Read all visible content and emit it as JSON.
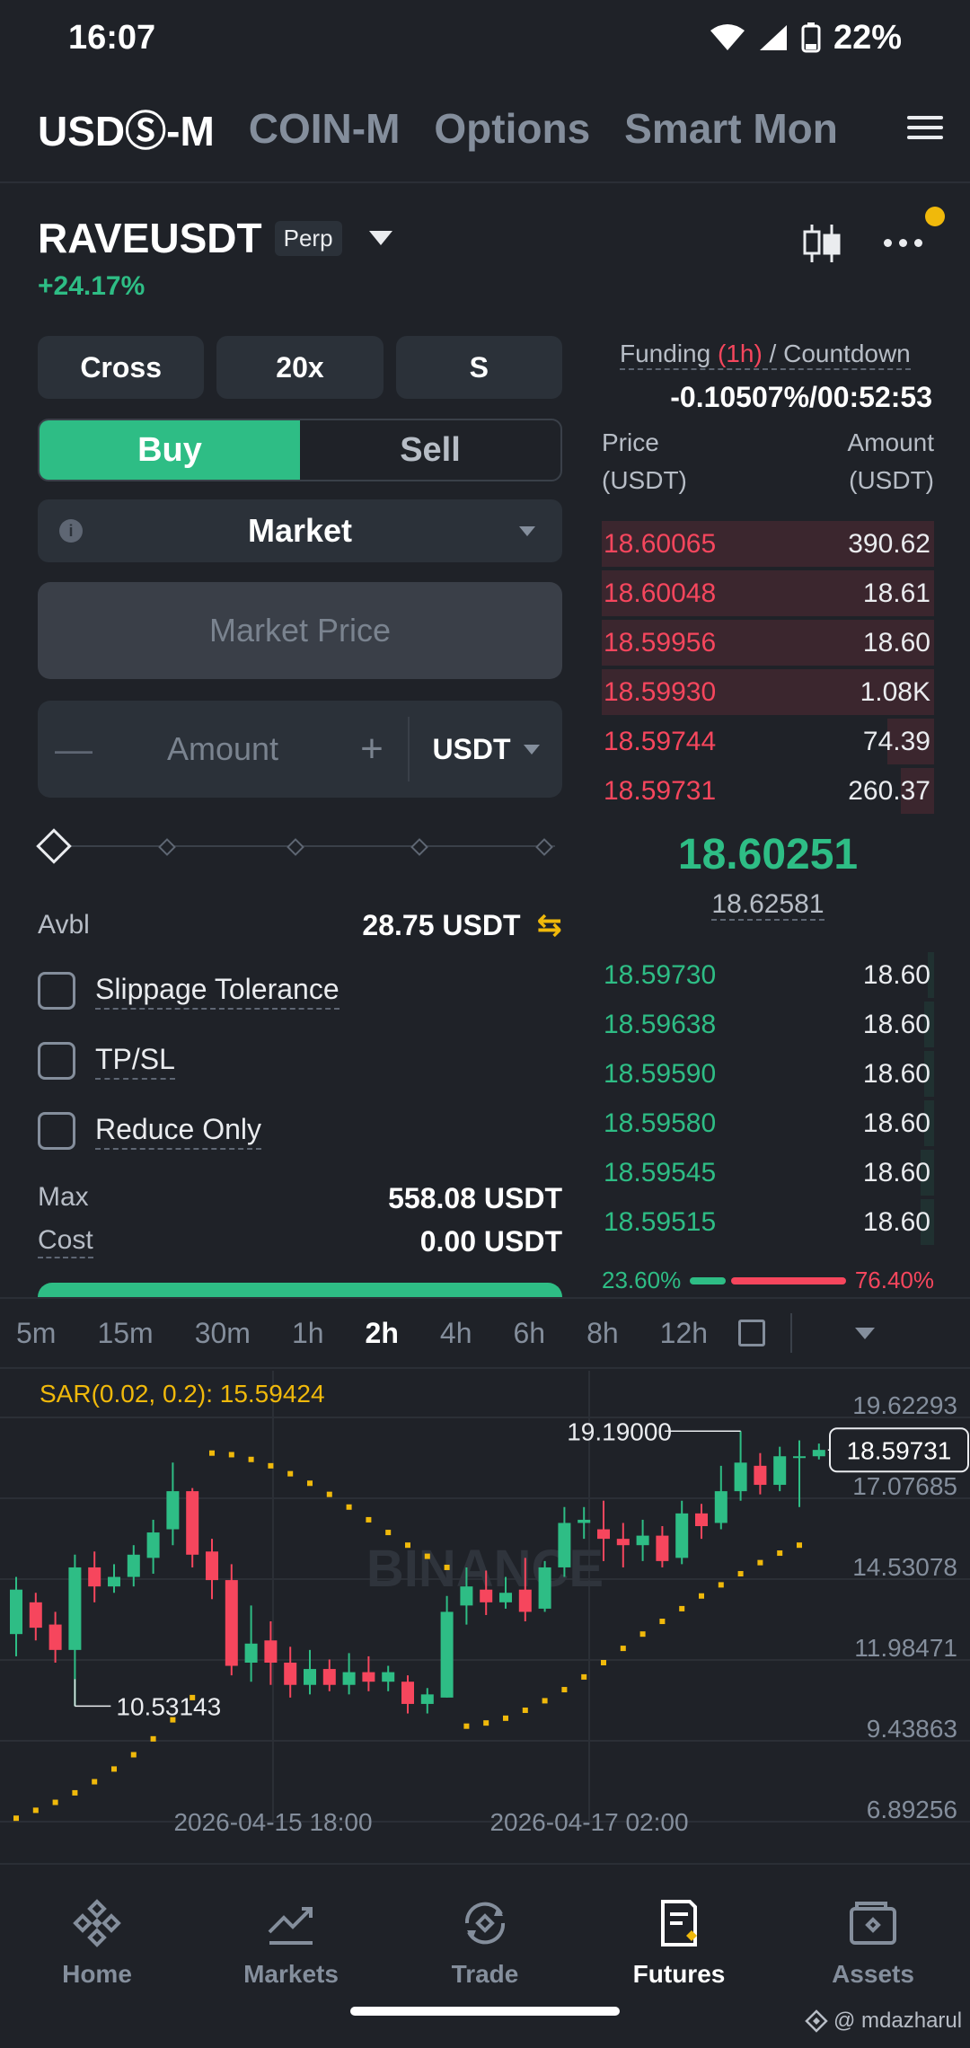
{
  "status": {
    "time": "16:07",
    "battery": "22%"
  },
  "top_tabs": [
    "USDⓈ-M",
    "COIN-M",
    "Options",
    "Smart Mon"
  ],
  "symbol": {
    "name": "RAVEUSDT",
    "badge": "Perp",
    "change": "+24.17%"
  },
  "options": {
    "margin_mode": "Cross",
    "leverage": "20x",
    "mode": "S"
  },
  "side": {
    "buy": "Buy",
    "sell": "Sell"
  },
  "order_type": "Market",
  "price_field": "Market Price",
  "amount": {
    "placeholder": "Amount",
    "unit": "USDT",
    "minus": "—",
    "plus": "+"
  },
  "avbl": {
    "label": "Avbl",
    "value": "28.75 USDT"
  },
  "checks": {
    "slippage": "Slippage Tolerance",
    "tpsl": "TP/SL",
    "reduce": "Reduce Only"
  },
  "max": {
    "label": "Max",
    "value": "558.08 USDT"
  },
  "cost": {
    "label": "Cost",
    "value": "0.00 USDT"
  },
  "funding": {
    "label_a": "Funding ",
    "label_hl": "(1h)",
    "label_b": " / Countdown",
    "value": "-0.10507%/00:52:53"
  },
  "orderbook": {
    "price_header_1": "Price",
    "price_header_2": "(USDT)",
    "amount_header_1": "Amount",
    "amount_header_2": "(USDT)",
    "asks": [
      {
        "price": "18.60065",
        "amount": "390.62",
        "depth": 1.0
      },
      {
        "price": "18.60048",
        "amount": "18.61",
        "depth": 1.0
      },
      {
        "price": "18.59956",
        "amount": "18.60",
        "depth": 1.0
      },
      {
        "price": "18.59930",
        "amount": "1.08K",
        "depth": 1.0
      },
      {
        "price": "18.59744",
        "amount": "74.39",
        "depth": 0.14
      },
      {
        "price": "18.59731",
        "amount": "260.37",
        "depth": 0.1
      }
    ],
    "last_price": "18.60251",
    "mark_price": "18.62581",
    "bids": [
      {
        "price": "18.59730",
        "amount": "18.60",
        "depth": 0.02
      },
      {
        "price": "18.59638",
        "amount": "18.60",
        "depth": 0.03
      },
      {
        "price": "18.59590",
        "amount": "18.60",
        "depth": 0.03
      },
      {
        "price": "18.59580",
        "amount": "18.60",
        "depth": 0.03
      },
      {
        "price": "18.59545",
        "amount": "18.60",
        "depth": 0.04
      },
      {
        "price": "18.59515",
        "amount": "18.60",
        "depth": 0.04
      }
    ],
    "buy_ratio": "23.60%",
    "sell_ratio": "76.40%",
    "buy_ratio_value": 23.6
  },
  "intervals": [
    "5m",
    "15m",
    "30m",
    "1h",
    "2h",
    "4h",
    "6h",
    "8h",
    "12h"
  ],
  "active_interval": "2h",
  "chart_data": {
    "type": "candlestick",
    "indicator": "SAR(0.02, 0.2): 15.59424",
    "watermark": "BINANCE",
    "y_ticks": [
      "19.62293",
      "17.07685",
      "14.53078",
      "11.98471",
      "9.43863",
      "6.89256"
    ],
    "x_ticks": [
      "2026-04-15 18:00",
      "2026-04-17 02:00"
    ],
    "high_label": "19.19000",
    "low_label": "10.53143",
    "current_label": "18.59731",
    "ylim": [
      6.89256,
      19.62293
    ],
    "candles": [
      [
        12.8,
        14.2,
        12.1,
        14.6
      ],
      [
        13.8,
        13.0,
        12.6,
        14.1
      ],
      [
        13.1,
        12.3,
        11.9,
        13.5
      ],
      [
        12.3,
        14.9,
        10.53,
        15.3
      ],
      [
        14.9,
        14.3,
        13.8,
        15.4
      ],
      [
        14.3,
        14.6,
        14.1,
        15.0
      ],
      [
        14.6,
        15.3,
        14.3,
        15.6
      ],
      [
        15.2,
        16.0,
        14.7,
        16.4
      ],
      [
        16.1,
        17.3,
        15.6,
        18.2
      ],
      [
        17.3,
        15.3,
        14.9,
        17.4
      ],
      [
        15.4,
        14.5,
        13.9,
        15.8
      ],
      [
        14.5,
        11.8,
        11.5,
        15.0
      ],
      [
        11.9,
        12.5,
        11.3,
        13.7
      ],
      [
        12.6,
        11.9,
        11.2,
        13.2
      ],
      [
        11.9,
        11.2,
        10.8,
        12.4
      ],
      [
        11.2,
        11.7,
        10.9,
        12.3
      ],
      [
        11.7,
        11.2,
        11.0,
        12.0
      ],
      [
        11.2,
        11.6,
        10.9,
        12.2
      ],
      [
        11.6,
        11.3,
        11.0,
        12.1
      ],
      [
        11.3,
        11.6,
        11.0,
        11.8
      ],
      [
        11.3,
        10.6,
        10.3,
        11.5
      ],
      [
        10.6,
        10.9,
        10.3,
        11.1
      ],
      [
        10.8,
        13.5,
        10.8,
        14.0
      ],
      [
        13.7,
        14.3,
        13.1,
        14.9
      ],
      [
        14.2,
        13.8,
        13.4,
        14.8
      ],
      [
        13.8,
        14.1,
        13.6,
        14.6
      ],
      [
        14.2,
        13.5,
        13.2,
        15.2
      ],
      [
        13.6,
        14.9,
        13.5,
        15.1
      ],
      [
        14.9,
        16.3,
        14.6,
        16.8
      ],
      [
        16.3,
        16.4,
        15.8,
        16.8
      ],
      [
        16.1,
        15.8,
        15.1,
        17.0
      ],
      [
        15.8,
        15.6,
        14.9,
        16.3
      ],
      [
        15.6,
        15.9,
        15.1,
        16.4
      ],
      [
        15.9,
        15.1,
        14.9,
        16.2
      ],
      [
        15.2,
        16.6,
        15.0,
        17.0
      ],
      [
        16.6,
        16.2,
        15.8,
        16.9
      ],
      [
        16.3,
        17.3,
        16.1,
        18.1
      ],
      [
        17.3,
        18.2,
        17.0,
        19.19
      ],
      [
        18.1,
        17.5,
        17.2,
        18.5
      ],
      [
        17.5,
        18.4,
        17.3,
        18.7
      ],
      [
        18.4,
        18.4,
        16.8,
        18.9
      ],
      [
        18.4,
        18.6,
        18.3,
        18.8
      ]
    ],
    "sar": [
      [
        0,
        7.0
      ],
      [
        1,
        7.25
      ],
      [
        2,
        7.5
      ],
      [
        3,
        7.8
      ],
      [
        4,
        8.15
      ],
      [
        5,
        8.55
      ],
      [
        6,
        9.0
      ],
      [
        7,
        9.5
      ],
      [
        8,
        10.1
      ],
      [
        9,
        10.8
      ],
      [
        10,
        18.5
      ],
      [
        11,
        18.45
      ],
      [
        12,
        18.3
      ],
      [
        13,
        18.1
      ],
      [
        14,
        17.85
      ],
      [
        15,
        17.55
      ],
      [
        16,
        17.2
      ],
      [
        17,
        16.8
      ],
      [
        18,
        16.4
      ],
      [
        19,
        16.0
      ],
      [
        20,
        15.6
      ],
      [
        21,
        15.25
      ],
      [
        22,
        14.9
      ],
      [
        23,
        9.9
      ],
      [
        24,
        10.0
      ],
      [
        25,
        10.15
      ],
      [
        26,
        10.4
      ],
      [
        27,
        10.7
      ],
      [
        28,
        11.05
      ],
      [
        29,
        11.45
      ],
      [
        30,
        11.9
      ],
      [
        31,
        12.35
      ],
      [
        32,
        12.8
      ],
      [
        33,
        13.2
      ],
      [
        34,
        13.6
      ],
      [
        35,
        14.0
      ],
      [
        36,
        14.35
      ],
      [
        37,
        14.7
      ],
      [
        38,
        15.05
      ],
      [
        39,
        15.35
      ],
      [
        40,
        15.6
      ]
    ]
  },
  "nav": [
    {
      "label": "Home",
      "icon": "home-icon"
    },
    {
      "label": "Markets",
      "icon": "markets-icon"
    },
    {
      "label": "Trade",
      "icon": "trade-icon"
    },
    {
      "label": "Futures",
      "icon": "futures-icon"
    },
    {
      "label": "Assets",
      "icon": "assets-icon"
    }
  ],
  "active_nav": "Futures",
  "watermark_credit": "@ mdazharul",
  "colors": {
    "bg": "#1f2228",
    "green": "#2ebd85",
    "red": "#f6465d",
    "yellow": "#f0b90b"
  }
}
